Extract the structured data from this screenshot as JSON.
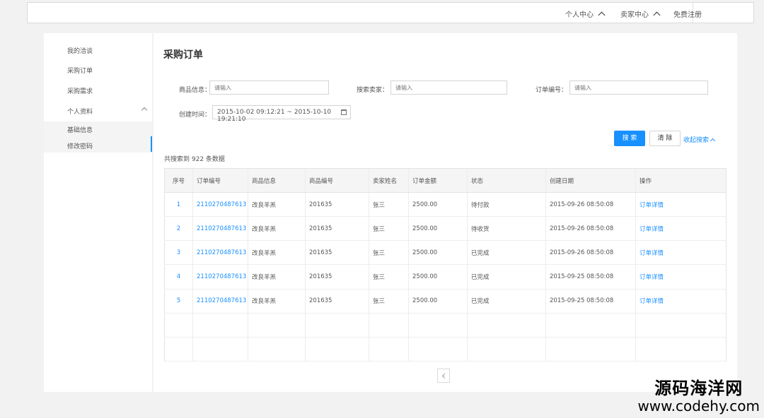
{
  "topbar": {
    "personal_center": "个人中心",
    "seller_center": "卖家中心",
    "register": "免费注册"
  },
  "sidebar": {
    "items": [
      {
        "label": "我的洽谈"
      },
      {
        "label": "采购订单"
      },
      {
        "label": "采购需求"
      },
      {
        "label": "个人资料"
      }
    ],
    "sub_items": [
      {
        "label": "基础信息"
      },
      {
        "label": "修改密码"
      }
    ]
  },
  "main": {
    "title": "采购订单",
    "filters": {
      "product_label": "商品信息：",
      "product_placeholder": "请输入",
      "seller_label": "搜索卖家：",
      "seller_placeholder": "请输入",
      "order_label": "订单编号：",
      "order_placeholder": "请输入",
      "created_label": "创建时间：",
      "date_range": "2015-10-02 09:12:21 ~ 2015-10-10 19:21:10"
    },
    "buttons": {
      "search": "搜 索",
      "clear": "清 除",
      "collapse": "收起搜索"
    },
    "result_count": "共搜索到 922 条数据",
    "table": {
      "columns": [
        "序号",
        "订单编号",
        "商品信息",
        "商品编号",
        "卖家姓名",
        "订单金额",
        "状态",
        "创建日期",
        "操作"
      ],
      "rows": [
        {
          "index": "1",
          "order_no": "2110270487613",
          "product": "改良羊羔",
          "product_no": "201635",
          "seller": "张三",
          "amount": "2500.00",
          "status": "待付款",
          "created": "2015-09-26 08:50:08",
          "action": "订单详情"
        },
        {
          "index": "2",
          "order_no": "2110270487613",
          "product": "改良羊羔",
          "product_no": "201635",
          "seller": "张三",
          "amount": "2500.00",
          "status": "待收货",
          "created": "2015-09-26 08:50:08",
          "action": "订单详情"
        },
        {
          "index": "3",
          "order_no": "2110270487613",
          "product": "改良羊羔",
          "product_no": "201635",
          "seller": "张三",
          "amount": "2500.00",
          "status": "已完成",
          "created": "2015-09-26 08:50:08",
          "action": "订单详情"
        },
        {
          "index": "4",
          "order_no": "2110270487613",
          "product": "改良羊羔",
          "product_no": "201635",
          "seller": "张三",
          "amount": "2500.00",
          "status": "已完成",
          "created": "2015-09-25 08:50:08",
          "action": "订单详情"
        },
        {
          "index": "5",
          "order_no": "2110270487613",
          "product": "改良羊羔",
          "product_no": "201635",
          "seller": "张三",
          "amount": "2500.00",
          "status": "已完成",
          "created": "2015-09-25 08:50:08",
          "action": "订单详情"
        }
      ]
    }
  },
  "watermark": {
    "name": "源码海洋网",
    "url": "www.codehy.com"
  }
}
